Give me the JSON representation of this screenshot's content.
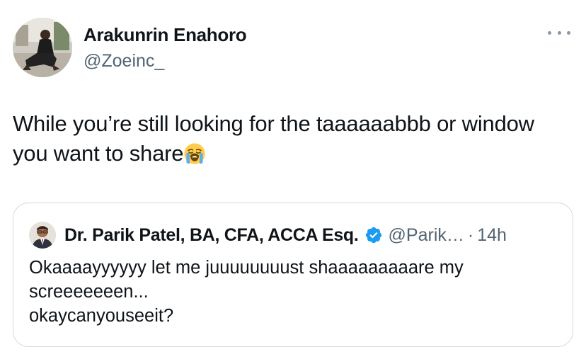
{
  "tweet": {
    "author_name": "Arakunrin Enahoro",
    "author_handle": "@Zoeinc_",
    "text_line1": "While you’re still looking for the taaaaaabbb or window",
    "text_line2": "you want to share",
    "emoji": "loudly-crying-face",
    "more_icon": "more-horizontal-icon"
  },
  "quote": {
    "author_name": "Dr. Parik Patel, BA, CFA, ACCA Esq.",
    "verified_icon": "verified-badge-icon",
    "verified_color": "#1d9bf0",
    "handle": "@Parik…",
    "separator": "·",
    "time": "14h",
    "text_lines": [
      "Okaaaayyyyyy let me juuuuuuuust shaaaaaaaaare my",
      "screeeeeeen...",
      "okaycanyouseeit?"
    ]
  },
  "colors": {
    "text": "#0f1419",
    "secondary": "#536471",
    "border": "#cfd9de"
  }
}
